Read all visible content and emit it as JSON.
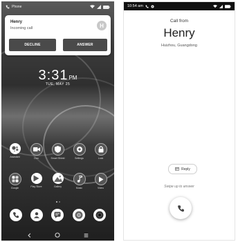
{
  "left": {
    "status_app": "Phone",
    "notification": {
      "caller": "Henry",
      "subtitle": "Incoming call",
      "avatar_letter": "H",
      "decline_label": "DECLINE",
      "answer_label": "ANSWER"
    },
    "clock": {
      "time": "3:31",
      "ampm": "PM",
      "date": "TUE, MAY 25"
    },
    "apps_row1": [
      {
        "label": "Assistant",
        "icon": "assistant-icon"
      },
      {
        "label": "Duo",
        "icon": "video-icon"
      },
      {
        "label": "Smart Shield",
        "icon": "shield-icon"
      },
      {
        "label": "Settings",
        "icon": "gear-icon"
      },
      {
        "label": "Lock",
        "icon": "lock-icon"
      }
    ],
    "apps_row2": [
      {
        "label": "Google",
        "icon": "google-icon"
      },
      {
        "label": "Play Store",
        "icon": "play-store-icon"
      },
      {
        "label": "Gallery",
        "icon": "gallery-icon"
      },
      {
        "label": "Music",
        "icon": "music-icon"
      },
      {
        "label": "Video",
        "icon": "play-icon"
      }
    ]
  },
  "right": {
    "status_time": "10:54 am",
    "call_from": "Call from",
    "caller_name": "Henry",
    "location": "Huizhou, Guangdong",
    "reply_label": "Reply",
    "swipe_hint": "Swipe up to answer"
  },
  "colors": {
    "notif_button": "#4a4a4a",
    "background": "#2f2f2f"
  }
}
